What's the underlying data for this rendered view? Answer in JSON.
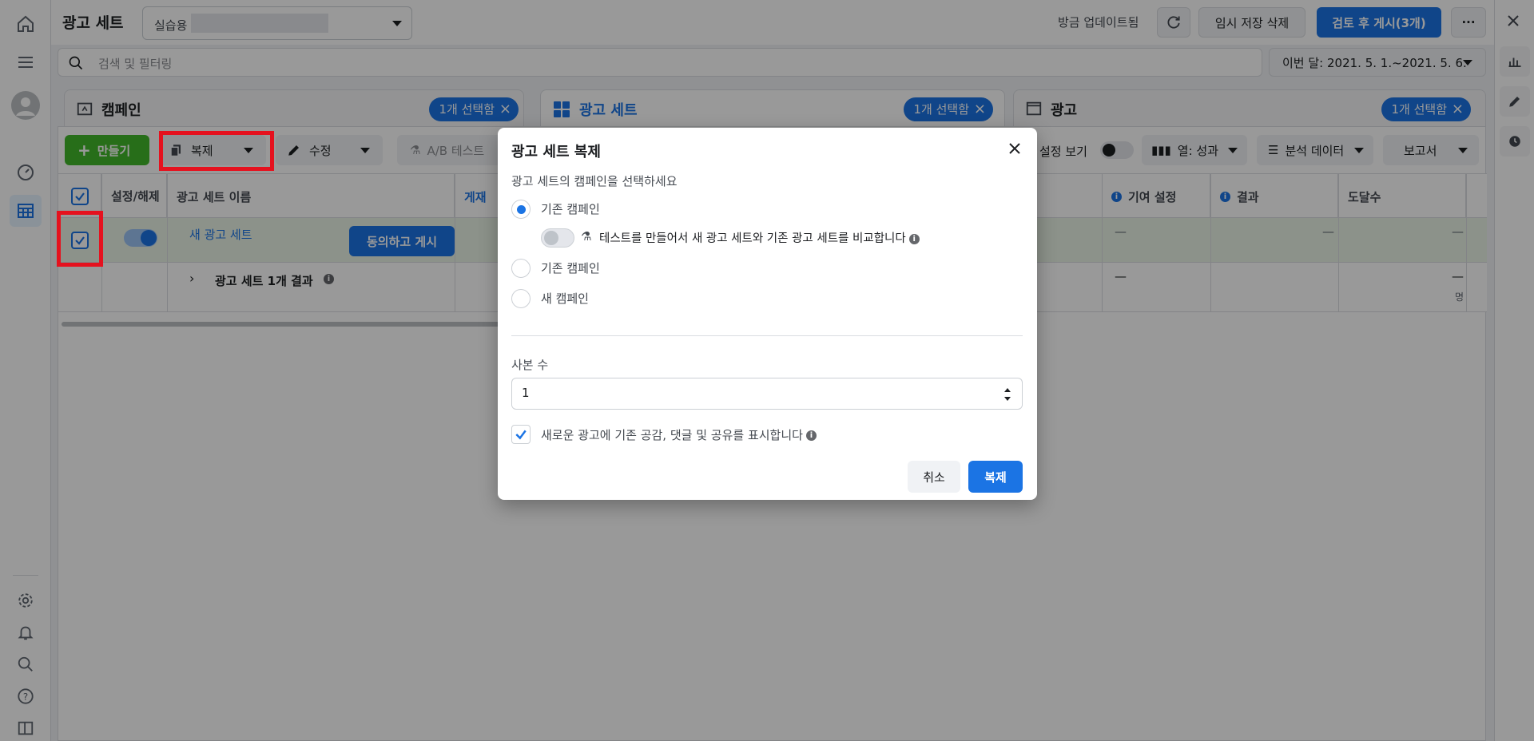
{
  "header": {
    "title": "광고 세트",
    "account_label": "실습용",
    "updated_text": "방금 업데이트됨",
    "discard_drafts": "임시 저장 삭제",
    "review_publish": "검토 후 게시(3개)",
    "more": "···"
  },
  "search": {
    "placeholder": "검색 및 필터링"
  },
  "date_range": "이번 달: 2021. 5. 1.~2021. 5. 6.",
  "tabs": [
    {
      "label": "캠페인",
      "pill": "1개 선택함"
    },
    {
      "label": "광고 세트",
      "pill": "1개 선택함"
    },
    {
      "label": "광고",
      "pill": "1개 선택함"
    }
  ],
  "toolbar": {
    "create": "만들기",
    "duplicate": "복제",
    "edit": "수정",
    "ab_test": "A/B 테스트",
    "setting_view": "설정 보기",
    "columns": "열: 성과",
    "breakdown": "분석 데이터",
    "reports": "보고서"
  },
  "table": {
    "headers": {
      "toggle": "설정/해제",
      "name": "광고 세트 이름",
      "delivery": "게재",
      "attribution": "기여 설정",
      "results": "결과",
      "reach": "도달수"
    },
    "row": {
      "name": "새 광고 세트",
      "publish_button": "동의하고 게시",
      "dash": "—"
    },
    "summary": {
      "label": "광고 세트 1개 결과",
      "reach_unit": "명"
    }
  },
  "modal": {
    "title": "광고 세트 복제",
    "campaign_prompt": "광고 세트의 캠페인을 선택하세요",
    "option_existing": "기존 캠페인",
    "test_toggle_text": "테스트를 만들어서 새 광고 세트와 기존 광고 세트를 비교합니다",
    "option_existing_2": "기존 캠페인",
    "option_new": "새 캠페인",
    "copies_label": "사본 수",
    "copies_value": "1",
    "show_engagement": "새로운 광고에 기존 공감, 댓글 및 공유를 표시합니다",
    "cancel": "취소",
    "confirm": "복제"
  },
  "colors": {
    "accent": "#1b74e4",
    "create_green": "#42b72a",
    "highlight_red": "#e5111e"
  }
}
